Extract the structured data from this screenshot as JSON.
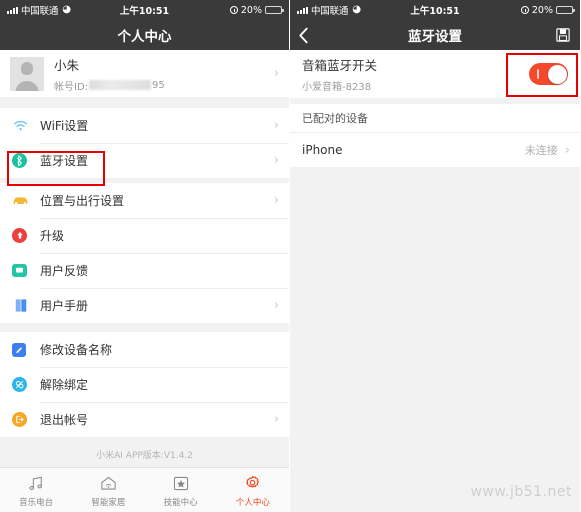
{
  "status_bar": {
    "carrier": "中国联通",
    "wifi_icon": "wifi-icon",
    "time": "上午10:51",
    "battery_percent": "20%",
    "alarm_icon": "alarm-icon"
  },
  "left_panel": {
    "nav": {
      "title": "个人中心"
    },
    "profile": {
      "avatar_icon": "avatar-placeholder-icon",
      "name": "小朱",
      "id_label": "帐号ID:",
      "id_suffix": "95",
      "chevron": "›"
    },
    "groups": [
      {
        "items": [
          {
            "label": "WiFi设置",
            "icon": "wifi-icon",
            "color": "#5bc2f0",
            "chevron": "›"
          },
          {
            "label": "蓝牙设置",
            "icon": "bluetooth-icon",
            "color": "#19c3a1",
            "chevron": "›"
          }
        ]
      },
      {
        "items": [
          {
            "label": "位置与出行设置",
            "icon": "car-icon",
            "color": "#f7b733",
            "chevron": "›"
          },
          {
            "label": "升级",
            "icon": "upgrade-arrow-icon",
            "color": "#ef3e3e",
            "chevron": ""
          },
          {
            "label": "用户反馈",
            "icon": "feedback-bubble-icon",
            "color": "#23c6a4",
            "chevron": ""
          },
          {
            "label": "用户手册",
            "icon": "manual-book-icon",
            "color": "#4a8df0",
            "chevron": "›"
          }
        ]
      },
      {
        "items": [
          {
            "label": "修改设备名称",
            "icon": "pencil-icon",
            "color": "#3d7ff0",
            "chevron": ""
          },
          {
            "label": "解除绑定",
            "icon": "unlink-icon",
            "color": "#29b6e8",
            "chevron": ""
          },
          {
            "label": "退出帐号",
            "icon": "logout-icon",
            "color": "#f5a623",
            "chevron": "›"
          }
        ]
      }
    ],
    "version_text": "小米AI APP版本:V1.4.2",
    "tabs": [
      {
        "label": "音乐电台",
        "icon": "music-note-icon",
        "active": false
      },
      {
        "label": "智能家居",
        "icon": "home-wifi-icon",
        "active": false
      },
      {
        "label": "技能中心",
        "icon": "star-square-icon",
        "active": false
      },
      {
        "label": "个人中心",
        "icon": "gear-icon",
        "active": true
      }
    ]
  },
  "right_panel": {
    "nav": {
      "back_icon": "back-chevron-icon",
      "title": "蓝牙设置",
      "save_icon": "save-floppy-icon"
    },
    "bluetooth_switch": {
      "title": "音箱蓝牙开关",
      "subtitle": "小爱音箱-8238",
      "toggle_state": "on",
      "toggle_color": "#f4492d"
    },
    "paired_section": {
      "header": "已配对的设备"
    },
    "devices": [
      {
        "name": "iPhone",
        "status": "未连接",
        "chevron": "›"
      }
    ]
  },
  "annotations": {
    "accent_color": "#e60000",
    "boxes": [
      {
        "name": "bluetooth-settings-highlight"
      },
      {
        "name": "bluetooth-toggle-highlight"
      }
    ]
  },
  "watermark": {
    "text": "www.jb51.net"
  }
}
